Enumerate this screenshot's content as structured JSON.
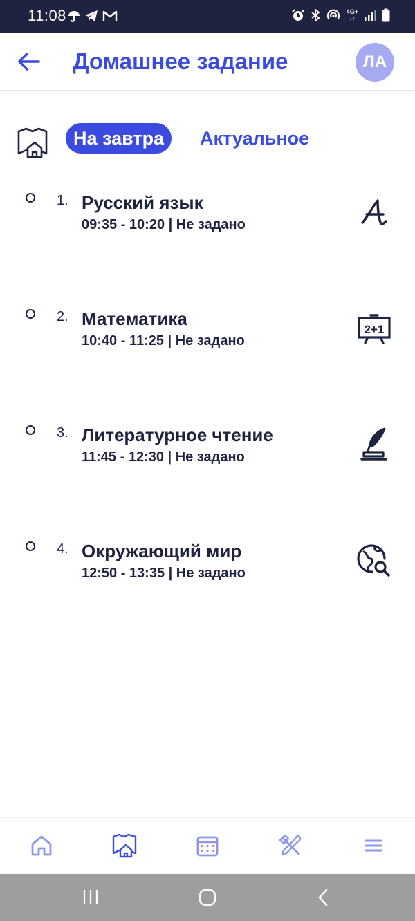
{
  "status_bar": {
    "time": "11:08",
    "network": "4G+"
  },
  "header": {
    "title": "Домашнее задание",
    "avatar_initials": "ЛА",
    "back_icon": "arrow-left-icon"
  },
  "tabs": [
    {
      "label": "На завтра",
      "active": true
    },
    {
      "label": "Актуальное",
      "active": false
    }
  ],
  "lessons": [
    {
      "number": "1.",
      "subject": "Русский язык",
      "time": "09:35 - 10:20",
      "status": "Не задано",
      "icon": "letter-a-icon"
    },
    {
      "number": "2.",
      "subject": "Математика",
      "time": "10:40 - 11:25",
      "status": "Не задано",
      "icon": "blackboard-math-icon"
    },
    {
      "number": "3.",
      "subject": "Литературное чтение",
      "time": "11:45 - 12:30",
      "status": "Не задано",
      "icon": "quill-inkwell-icon"
    },
    {
      "number": "4.",
      "subject": "Окружающий мир",
      "time": "12:50 - 13:35",
      "status": "Не задано",
      "icon": "globe-search-icon"
    }
  ],
  "bottom_nav": [
    "home-icon",
    "homework-icon",
    "calendar-icon",
    "tools-icon",
    "menu-icon"
  ],
  "colors": {
    "accent": "#3b4bdf",
    "text_dark": "#1f2340",
    "avatar_bg": "#a6aaf0",
    "nav_inactive": "#8f95e8",
    "status_bar": "#1f2340"
  }
}
